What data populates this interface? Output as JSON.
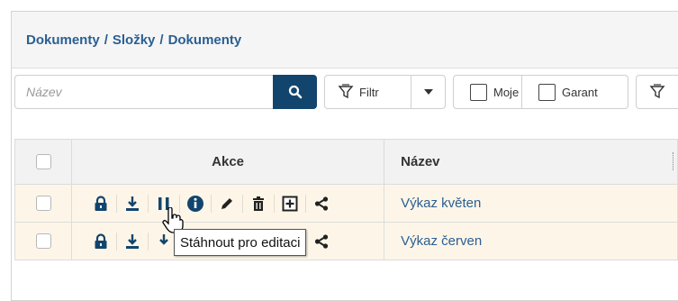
{
  "breadcrumb": [
    "Dokumenty",
    "Složky",
    "Dokumenty"
  ],
  "breadcrumb_separator": "/",
  "search": {
    "placeholder": "Název"
  },
  "toolbar": {
    "filter_label": "Filtr",
    "moje_label": "Moje",
    "garant_label": "Garant"
  },
  "table": {
    "headers": {
      "akce": "Akce",
      "nazev": "Název"
    },
    "rows": [
      {
        "name": "Výkaz květen"
      },
      {
        "name": "Výkaz červen"
      }
    ]
  },
  "tooltip": {
    "text": "Stáhnout pro editaci"
  },
  "colors": {
    "accent": "#12456e",
    "link": "#2a5f93",
    "row_bg": "#fdf6e8"
  },
  "action_icons": [
    "lock-icon",
    "download-icon",
    "download-edit-icon",
    "info-icon",
    "pencil-icon",
    "trash-icon",
    "plus-box-icon",
    "share-icon"
  ]
}
